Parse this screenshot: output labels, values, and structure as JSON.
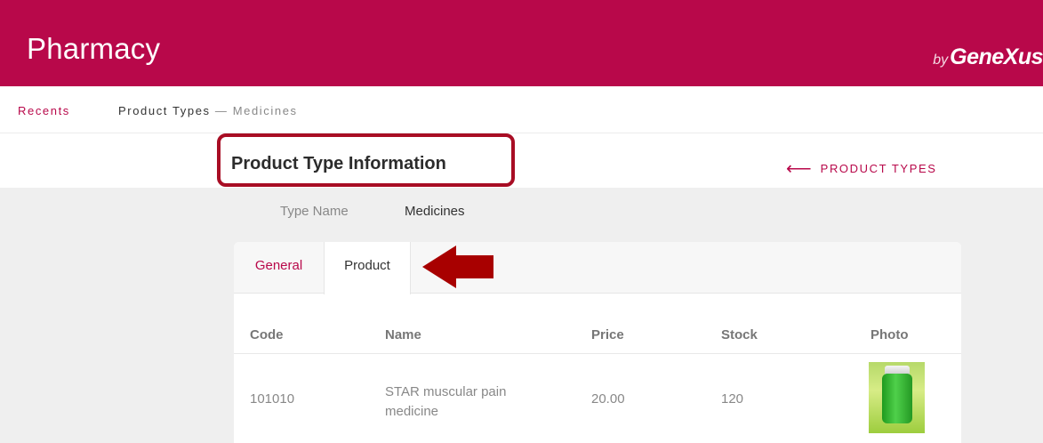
{
  "header": {
    "title": "Pharmacy",
    "brand_by": "by",
    "brand_name": "GeneXus"
  },
  "breadcrumb": {
    "recents": "Recents",
    "current_main": "Product Types",
    "separator": " — ",
    "current_sub": "Medicines"
  },
  "page": {
    "title": "Product Type Information",
    "back_link": "PRODUCT TYPES",
    "back_icon": "arrow-left-icon"
  },
  "fields": {
    "type_name_label": "Type Name",
    "type_name_value": "Medicines"
  },
  "tabs": [
    {
      "label": "General",
      "selected": false
    },
    {
      "label": "Product",
      "selected": true
    }
  ],
  "grid": {
    "columns": [
      "Code",
      "Name",
      "Price",
      "Stock",
      "Photo"
    ],
    "rows": [
      {
        "code": "101010",
        "name": "STAR muscular pain medicine",
        "price": "20.00",
        "stock": "120",
        "photo": "green-medicine-bottle"
      }
    ]
  },
  "colors": {
    "brand": "#b8084a",
    "highlight": "#a80d24",
    "content_bg": "#efefef"
  }
}
